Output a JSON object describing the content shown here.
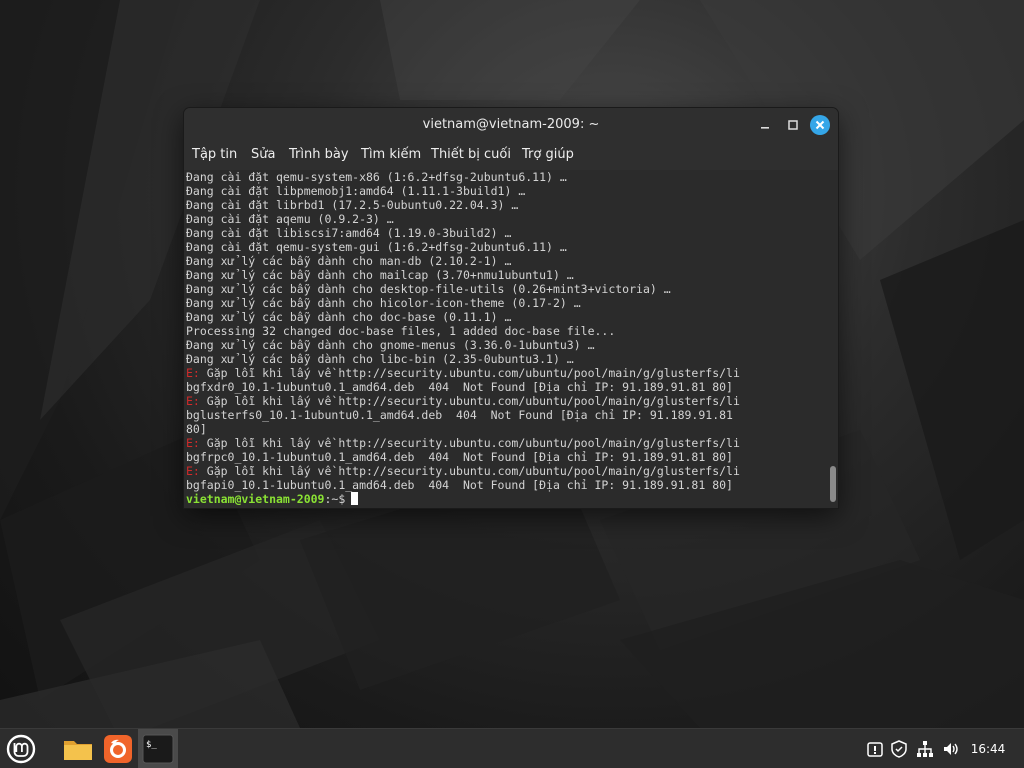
{
  "window": {
    "title": "vietnam@vietnam-2009: ~"
  },
  "menu": {
    "items": [
      "Tập tin",
      "Sửa",
      "Trình bày",
      "Tìm kiếm",
      "Thiết bị cuối",
      "Trợ giúp"
    ]
  },
  "terminal": {
    "lines": [
      {
        "type": "normal",
        "text": "Đang cài đặt qemu-system-x86 (1:6.2+dfsg-2ubuntu6.11) …"
      },
      {
        "type": "normal",
        "text": "Đang cài đặt libpmemobj1:amd64 (1.11.1-3build1) …"
      },
      {
        "type": "normal",
        "text": "Đang cài đặt librbd1 (17.2.5-0ubuntu0.22.04.3) …"
      },
      {
        "type": "normal",
        "text": "Đang cài đặt aqemu (0.9.2-3) …"
      },
      {
        "type": "normal",
        "text": "Đang cài đặt libiscsi7:amd64 (1.19.0-3build2) …"
      },
      {
        "type": "normal",
        "text": "Đang cài đặt qemu-system-gui (1:6.2+dfsg-2ubuntu6.11) …"
      },
      {
        "type": "normal",
        "text": "Đang xử lý các bẫy dành cho man-db (2.10.2-1) …"
      },
      {
        "type": "normal",
        "text": "Đang xử lý các bẫy dành cho mailcap (3.70+nmu1ubuntu1) …"
      },
      {
        "type": "normal",
        "text": "Đang xử lý các bẫy dành cho desktop-file-utils (0.26+mint3+victoria) …"
      },
      {
        "type": "normal",
        "text": "Đang xử lý các bẫy dành cho hicolor-icon-theme (0.17-2) …"
      },
      {
        "type": "normal",
        "text": "Đang xử lý các bẫy dành cho doc-base (0.11.1) …"
      },
      {
        "type": "normal",
        "text": "Processing 32 changed doc-base files, 1 added doc-base file..."
      },
      {
        "type": "normal",
        "text": "Đang xử lý các bẫy dành cho gnome-menus (3.36.0-1ubuntu3) …"
      },
      {
        "type": "normal",
        "text": "Đang xử lý các bẫy dành cho libc-bin (2.35-0ubuntu3.1) …"
      },
      {
        "type": "error",
        "prefix": "E:",
        "text": " Gặp lỗi khi lấy về http://security.ubuntu.com/ubuntu/pool/main/g/glusterfs/li"
      },
      {
        "type": "normal",
        "text": "bgfxdr0_10.1-1ubuntu0.1_amd64.deb  404  Not Found [Địa chỉ IP: 91.189.91.81 80]"
      },
      {
        "type": "error",
        "prefix": "E:",
        "text": " Gặp lỗi khi lấy về http://security.ubuntu.com/ubuntu/pool/main/g/glusterfs/li"
      },
      {
        "type": "normal",
        "text": "bglusterfs0_10.1-1ubuntu0.1_amd64.deb  404  Not Found [Địa chỉ IP: 91.189.91.81"
      },
      {
        "type": "normal",
        "text": "80]"
      },
      {
        "type": "error",
        "prefix": "E:",
        "text": " Gặp lỗi khi lấy về http://security.ubuntu.com/ubuntu/pool/main/g/glusterfs/li"
      },
      {
        "type": "normal",
        "text": "bgfrpc0_10.1-1ubuntu0.1_amd64.deb  404  Not Found [Địa chỉ IP: 91.189.91.81 80]"
      },
      {
        "type": "error",
        "prefix": "E:",
        "text": " Gặp lỗi khi lấy về http://security.ubuntu.com/ubuntu/pool/main/g/glusterfs/li"
      },
      {
        "type": "normal",
        "text": "bgfapi0_10.1-1ubuntu0.1_amd64.deb  404  Not Found [Địa chỉ IP: 91.189.91.81 80]"
      }
    ],
    "prompt": {
      "user_host": "vietnam@vietnam-2009",
      "path": ":~$"
    }
  },
  "taskbar": {
    "launchers": [
      "mint-menu-icon",
      "files-folder-icon",
      "firefox-icon",
      "terminal-icon"
    ],
    "tray": [
      "update-manager-icon",
      "shield-icon",
      "network-icon",
      "volume-icon"
    ],
    "clock": "16:44"
  },
  "colors": {
    "close_button": "#35a6e8",
    "prompt_user": "#8ae234",
    "error_prefix": "#d02a2a",
    "terminal_bg": "#2b2b2b",
    "titlebar_bg": "#2f2f2f",
    "taskbar_bg": "#2d2d2d"
  }
}
